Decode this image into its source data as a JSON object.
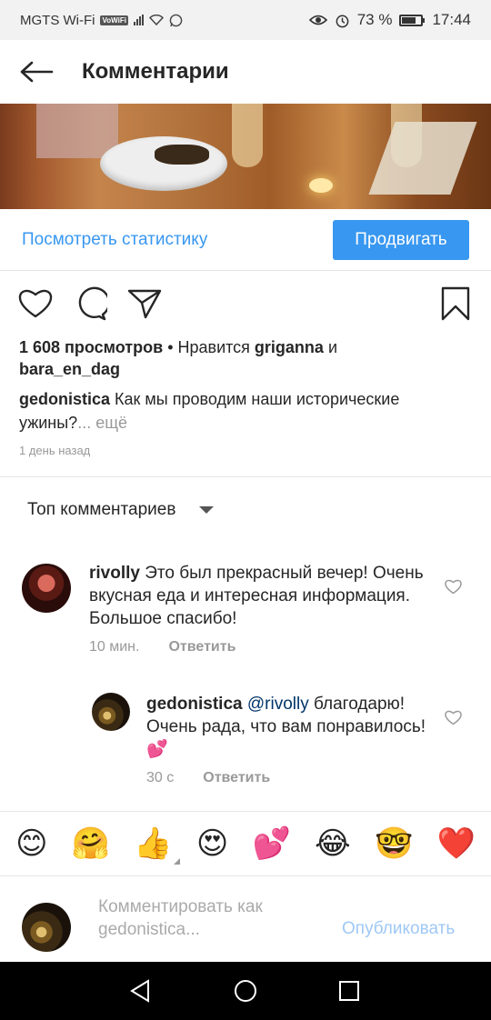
{
  "status_bar": {
    "carrier": "MGTS Wi-Fi",
    "volte": "VoWiFi",
    "battery": "73 %",
    "battery_level": 0.73,
    "time": "17:44"
  },
  "header": {
    "title": "Комментарии"
  },
  "stats": {
    "link": "Посмотреть статистику",
    "promote": "Продвигать"
  },
  "post": {
    "views": "1 608 просмотров",
    "likes_sep": " • Нравится ",
    "liker1": "griganna",
    "and": " и",
    "liker2": "bara_en_dag",
    "author": "gedonistica",
    "caption": " Как мы проводим наши исторические ужины?",
    "more": "... ещё",
    "time_ago": "1 день назад"
  },
  "sort": {
    "label": "Топ комментариев"
  },
  "comments": [
    {
      "user": "rivolly",
      "text": " Это был прекрасный вечер! Очень вкусная еда и интересная информация. Большое спасибо!",
      "time": "10 мин.",
      "reply": "Ответить"
    },
    {
      "user": "gedonistica",
      "mention": "@rivolly",
      "text": " благодарю! Очень рада, что вам понравилось! ",
      "emoji": "💕",
      "time": "30 с",
      "reply": "Ответить"
    }
  ],
  "emoji_bar": [
    "😊",
    "🤗",
    "👍",
    "😍",
    "💕",
    "😂",
    "🤓",
    "❤️"
  ],
  "compose": {
    "placeholder": "Комментировать как gedonistica...",
    "publish": "Опубликовать"
  },
  "colors": {
    "link_blue": "#3897f0",
    "mention_blue": "#003569",
    "muted": "#999999"
  }
}
